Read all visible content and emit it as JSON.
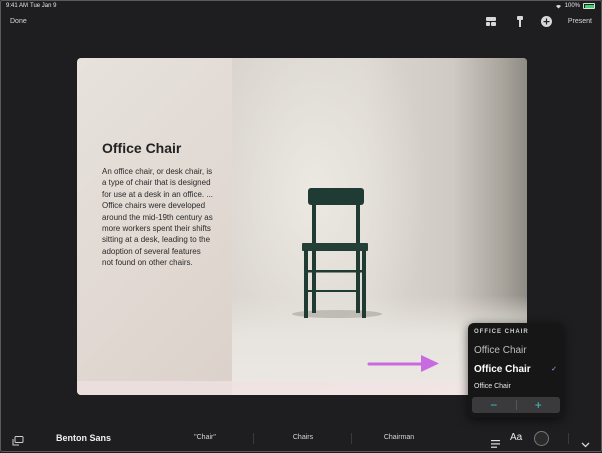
{
  "status": {
    "time": "9:41 AM",
    "date": "Tue Jan 9",
    "battery": "100%"
  },
  "toolbar": {
    "done_label": "Done",
    "present_label": "Present"
  },
  "slide": {
    "title": "Office Chair",
    "body": "An office chair, or desk chair, is a type of chair that is designed for use at a desk in an office. ... Office chairs were developed around the mid-19th century as more workers spent their shifts sitting at a desk, leading to the adoption of several features not found on other chairs."
  },
  "popover": {
    "header": "OFFICE CHAIR",
    "options": [
      "Office Chair",
      "Office Chair",
      "Office Chair"
    ],
    "selected_index": 1,
    "minus": "−",
    "plus": "+"
  },
  "bottombar": {
    "font_name": "Benton Sans",
    "suggestions": [
      "\"Chair\"",
      "Chairs",
      "Chairman"
    ],
    "aa_label": "Aa"
  },
  "colors": {
    "accent_arrow": "#c86be0",
    "stepper_accent": "#3fc2c9"
  },
  "icons": [
    "wifi-icon",
    "battery-icon",
    "layout-icon",
    "paintbrush-icon",
    "add-icon",
    "keyboard-undock-icon",
    "align-icon",
    "chevron-down-icon"
  ]
}
